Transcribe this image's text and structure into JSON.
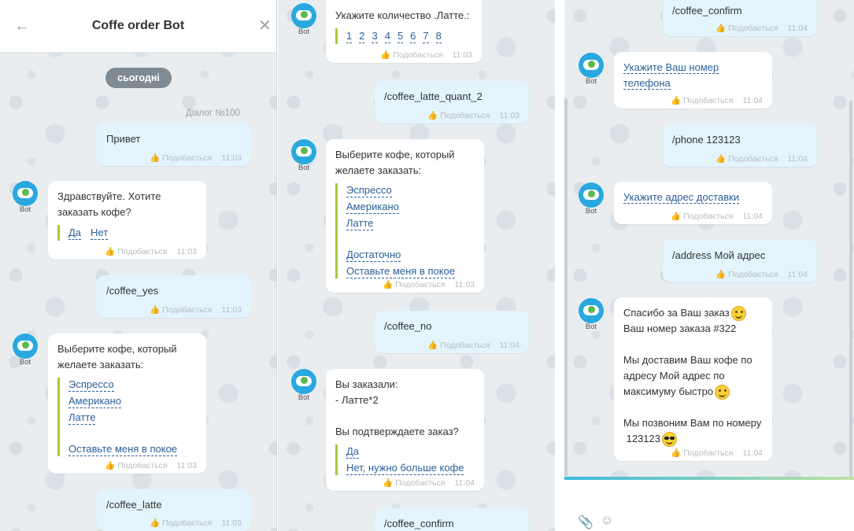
{
  "header": {
    "title": "Coffe order Bot",
    "back_icon": "arrow-left-icon",
    "close_icon": "close-icon"
  },
  "date_badge": "сьогодні",
  "dialog_label": "Діалог №100",
  "avatar_label": "Bot",
  "like_label": "Подобається",
  "panel1": {
    "m1": {
      "text": "Привет",
      "time": "11:03"
    },
    "m2": {
      "text": "Здравствуйте. Хотите\nзаказать кофе?",
      "options": [
        "Да",
        "Нет"
      ],
      "time": "11:03"
    },
    "m3": {
      "text": "/coffee_yes",
      "time": "11:03"
    },
    "m4": {
      "text": "Выберите кофе, который\nжелаете заказать:",
      "options": [
        "Эспрессо",
        "Американо",
        "Латте"
      ],
      "extra_option": "Оставьте меня в покое",
      "time": "11:03"
    },
    "m5": {
      "text": "/coffee_latte",
      "time": "11:03"
    }
  },
  "panel2": {
    "m1": {
      "text": "Укажите количество .Латте.:",
      "options": [
        "1",
        "2",
        "3",
        "4",
        "5",
        "6",
        "7",
        "8"
      ],
      "time": "11:03"
    },
    "m2": {
      "text": "/coffee_latte_quant_2",
      "time": "11:03"
    },
    "m3": {
      "text": "Выберите кофе, который\nжелаете заказать:",
      "options": [
        "Эспрессо",
        "Американо",
        "Латте"
      ],
      "extra_options": [
        "Достаточно",
        "Оставьте меня в покое"
      ],
      "time": "11:03"
    },
    "m4": {
      "text": "/coffee_no",
      "time": "11:04"
    },
    "m5": {
      "text": "Вы заказали:\n- Латте*2\n\nВы подтверждаете заказ?",
      "options": [
        "Да",
        "Нет, нужно больше кофе"
      ],
      "time": "11:04"
    },
    "m6": {
      "text": "/coffee_confirm"
    }
  },
  "panel3": {
    "m1": {
      "text": "/coffee_confirm",
      "time": "11:04"
    },
    "m2": {
      "text_line1": "Укажите Ваш номер",
      "text_line2": "телефона",
      "time": "11:04"
    },
    "m3": {
      "text": "/phone 123123",
      "time": "11:04"
    },
    "m4": {
      "text": "Укажите адрес доставки",
      "time": "11:04"
    },
    "m5": {
      "text": "/address Мой адрес",
      "time": "11:04"
    },
    "m6": {
      "line1": "Спасибо за Ваш заказ",
      "line2": "Ваш номер заказа #322",
      "line3": "Мы доставим Ваш кофе по",
      "line4": "адресу  Мой адрес по",
      "line5": "максимуму быстро",
      "line6": "Мы позвоним Вам по номеру",
      "line7": " 123123",
      "time": "11:04"
    }
  },
  "composer": {
    "attach_icon": "paperclip-icon",
    "emoji_icon": "smile-icon"
  }
}
